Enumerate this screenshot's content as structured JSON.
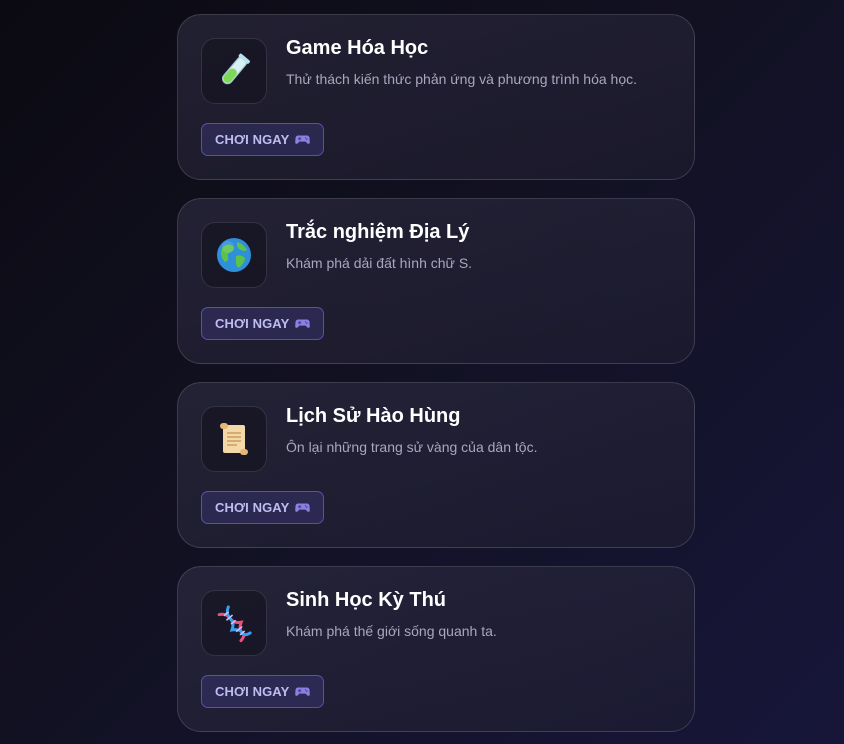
{
  "cards": [
    {
      "title": "Game Hóa Học",
      "description": "Thử thách kiến thức phản ứng và phương trình hóa học.",
      "icon": "test-tube-icon",
      "button_label": "CHƠI NGAY",
      "button_icon": "game-controller-icon"
    },
    {
      "title": "Trắc nghiệm Địa Lý",
      "description": "Khám phá dải đất hình chữ S.",
      "icon": "globe-icon",
      "button_label": "CHƠI NGAY",
      "button_icon": "game-controller-icon"
    },
    {
      "title": "Lịch Sử Hào Hùng",
      "description": "Ôn lại những trang sử vàng của dân tộc.",
      "icon": "scroll-icon",
      "button_label": "CHƠI NGAY",
      "button_icon": "game-controller-icon"
    },
    {
      "title": "Sinh Học Kỳ Thú",
      "description": "Khám phá thế giới sống quanh ta.",
      "icon": "dna-icon",
      "button_label": "CHƠI NGAY",
      "button_icon": "game-controller-icon"
    }
  ],
  "colors": {
    "button_text": "#bfbcf2",
    "button_border": "#7c76e6",
    "title_text": "#ffffff",
    "description_text": "#a9a7bd"
  }
}
